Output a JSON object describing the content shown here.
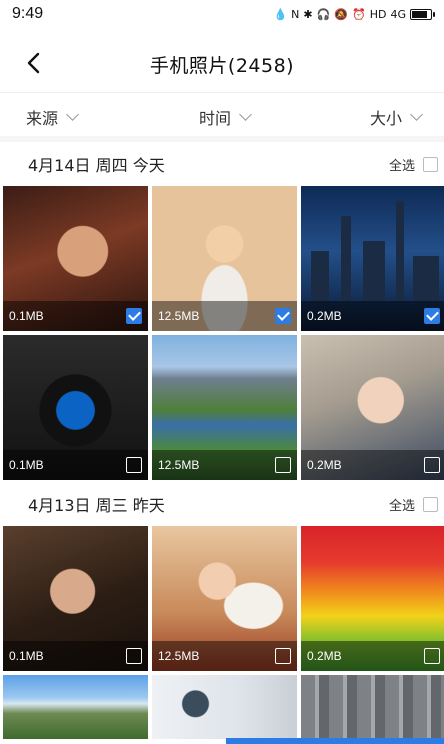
{
  "status": {
    "time": "9:49",
    "network": "HD",
    "signal": "4G"
  },
  "header": {
    "title": "手机照片(2458)",
    "back_icon": "chevron-left-icon"
  },
  "filters": [
    {
      "label": "来源"
    },
    {
      "label": "时间"
    },
    {
      "label": "大小"
    }
  ],
  "sections": [
    {
      "date": "4月14日 周四 今天",
      "select_all": "全选",
      "photos": [
        {
          "size": "0.1MB",
          "checked": true
        },
        {
          "size": "12.5MB",
          "checked": true
        },
        {
          "size": "0.2MB",
          "checked": true
        },
        {
          "size": "0.1MB",
          "checked": false
        },
        {
          "size": "12.5MB",
          "checked": false
        },
        {
          "size": "0.2MB",
          "checked": false
        }
      ]
    },
    {
      "date": "4月13日 周三 昨天",
      "select_all": "全选",
      "photos": [
        {
          "size": "0.1MB",
          "checked": false
        },
        {
          "size": "12.5MB",
          "checked": false
        },
        {
          "size": "0.2MB",
          "checked": false
        }
      ]
    }
  ],
  "colors": {
    "accent": "#2d7be5"
  }
}
